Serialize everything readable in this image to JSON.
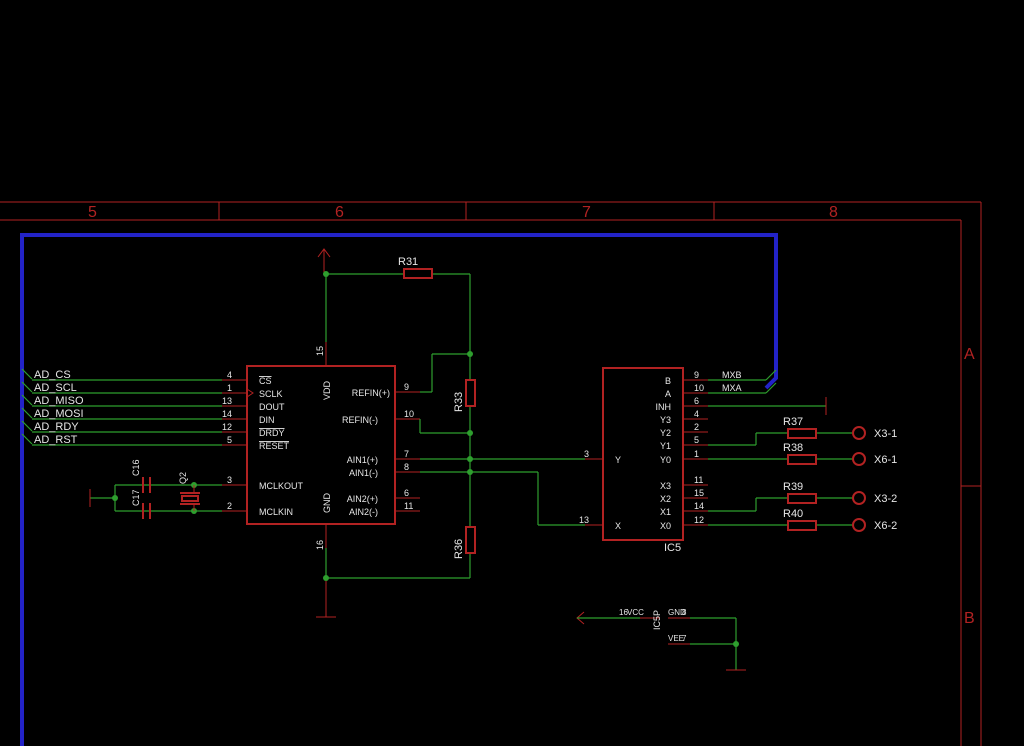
{
  "frame": {
    "columns": [
      "5",
      "6",
      "7",
      "8"
    ],
    "rows": [
      "A",
      "B"
    ]
  },
  "bus_signals": [
    "AD_CS",
    "AD_SCL",
    "AD_MISO",
    "AD_MOSI",
    "AD_RDY",
    "AD_RST"
  ],
  "adc": {
    "left_pins": [
      {
        "num": "4",
        "name": "CS"
      },
      {
        "num": "1",
        "name": "SCLK"
      },
      {
        "num": "13",
        "name": "DOUT"
      },
      {
        "num": "14",
        "name": "DIN"
      },
      {
        "num": "12",
        "name": "DRDY"
      },
      {
        "num": "5",
        "name": "RESET"
      },
      {
        "num": "3",
        "name": "MCLKOUT"
      },
      {
        "num": "2",
        "name": "MCLKIN"
      }
    ],
    "right_pins": [
      {
        "num": "9",
        "name": "REFIN(+)"
      },
      {
        "num": "10",
        "name": "REFIN(-)"
      },
      {
        "num": "7",
        "name": "AIN1(+)"
      },
      {
        "num": "8",
        "name": "AIN1(-)"
      },
      {
        "num": "6",
        "name": "AIN2(+)"
      },
      {
        "num": "11",
        "name": "AIN2(-)"
      }
    ],
    "vdd_label": "VDD",
    "vdd_pin": "15",
    "gnd_label": "GND",
    "gnd_pin": "16"
  },
  "mux": {
    "name": "IC5",
    "right_pins": [
      {
        "num": "9",
        "name": "B"
      },
      {
        "num": "10",
        "name": "A"
      },
      {
        "num": "6",
        "name": "INH"
      },
      {
        "num": "4",
        "name": "Y3"
      },
      {
        "num": "2",
        "name": "Y2"
      },
      {
        "num": "5",
        "name": "Y1"
      },
      {
        "num": "1",
        "name": "Y0"
      },
      {
        "num": "11",
        "name": "X3"
      },
      {
        "num": "15",
        "name": "X2"
      },
      {
        "num": "14",
        "name": "X1"
      },
      {
        "num": "12",
        "name": "X0"
      }
    ],
    "left_pins": [
      {
        "num": "3",
        "name": "Y"
      },
      {
        "num": "13",
        "name": "X"
      }
    ],
    "net_mxb": "MXB",
    "net_mxa": "MXA"
  },
  "resistors": {
    "r31": "R31",
    "r33": "R33",
    "r36": "R36",
    "r37": "R37",
    "r38": "R38",
    "r39": "R39",
    "r40": "R40"
  },
  "connectors": {
    "x3_1": "X3-1",
    "x6_1": "X6-1",
    "x3_2": "X3-2",
    "x6_2": "X6-2"
  },
  "caps": {
    "c17": "C17",
    "c16": "C16"
  },
  "crystal": "Q2",
  "power_part": {
    "name": "IC5P",
    "pin_vcc": "16",
    "vcc": "VCC",
    "gnd": "GND",
    "gnd_pin": "8",
    "vee": "VEE",
    "vee_pin": "7"
  },
  "colors": {
    "background": "#000000",
    "component": "#b22222",
    "net": "#2e9e2e",
    "bus": "#2323c8",
    "text": "#e6e6e6"
  }
}
